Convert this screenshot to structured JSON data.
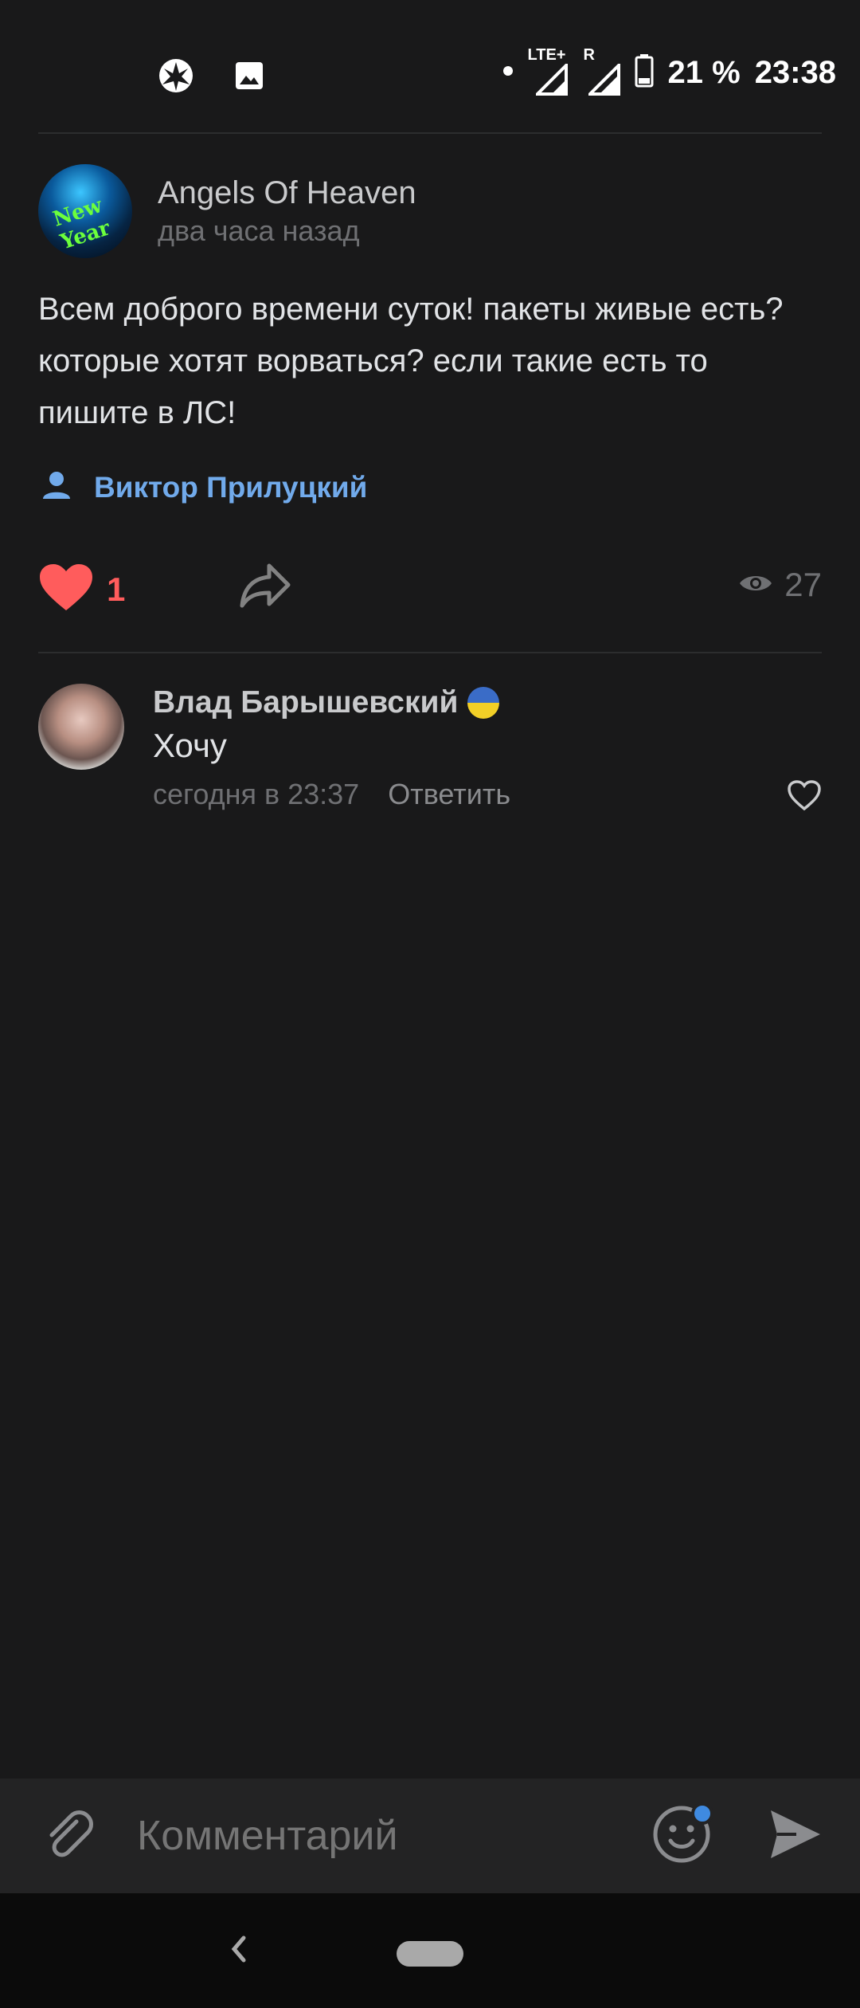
{
  "status_bar": {
    "network": "LTE+",
    "roaming": "R",
    "battery": "21 %",
    "time": "23:38"
  },
  "post": {
    "group_name": "Angels Of Heaven",
    "time": "два часа назад",
    "text": "Всем доброго времени суток! пакеты живые есть? которые хотят ворваться? если такие есть то пишите в ЛС!",
    "author": "Виктор Прилуцкий",
    "like_count": "1",
    "views_count": "27"
  },
  "comment": {
    "author": "Влад Барышевский",
    "text": "Хочу",
    "time": "сегодня в 23:37",
    "reply_label": "Ответить"
  },
  "composer": {
    "placeholder": "Комментарий"
  },
  "colors": {
    "background": "#19191a",
    "accent": "#71aaeb",
    "like": "#ff5c5c"
  }
}
